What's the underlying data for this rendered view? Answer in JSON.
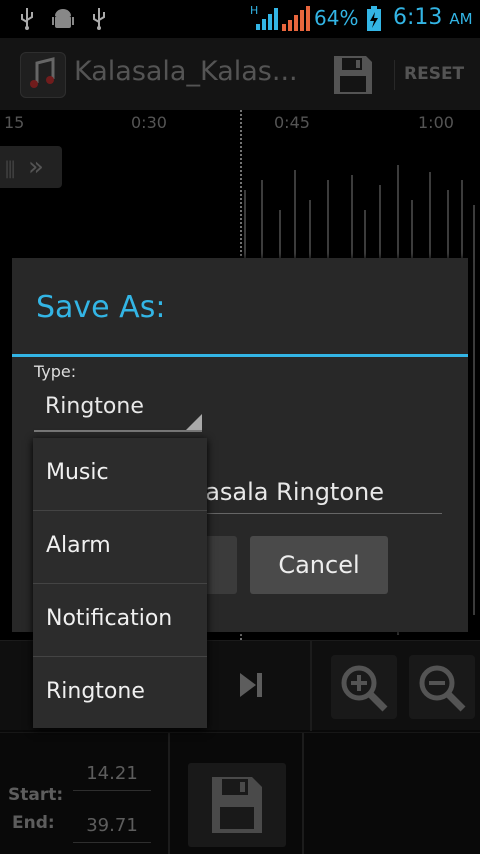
{
  "status_bar": {
    "battery_percent": "64%",
    "time": "6:13",
    "am_pm": "AM",
    "network_type": "H"
  },
  "action_bar": {
    "title": "Kalasala_Kalas...",
    "reset_label": "RESET"
  },
  "waveform": {
    "time_ticks": [
      "15",
      "0:30",
      "0:45",
      "1:00"
    ]
  },
  "dialog": {
    "title": "Save As:",
    "type_label": "Type:",
    "selected_type": "Ringtone",
    "name_value": "asala Ringtone",
    "cancel_label": "Cancel"
  },
  "dropdown": {
    "options": [
      "Music",
      "Alarm",
      "Notification",
      "Ringtone"
    ]
  },
  "editor": {
    "start_label": "Start:",
    "end_label": "End:",
    "start_value": "14.21",
    "end_value": "39.71"
  },
  "colors": {
    "accent": "#33b5e5",
    "background": "#000000",
    "dialog_bg": "#282828"
  }
}
